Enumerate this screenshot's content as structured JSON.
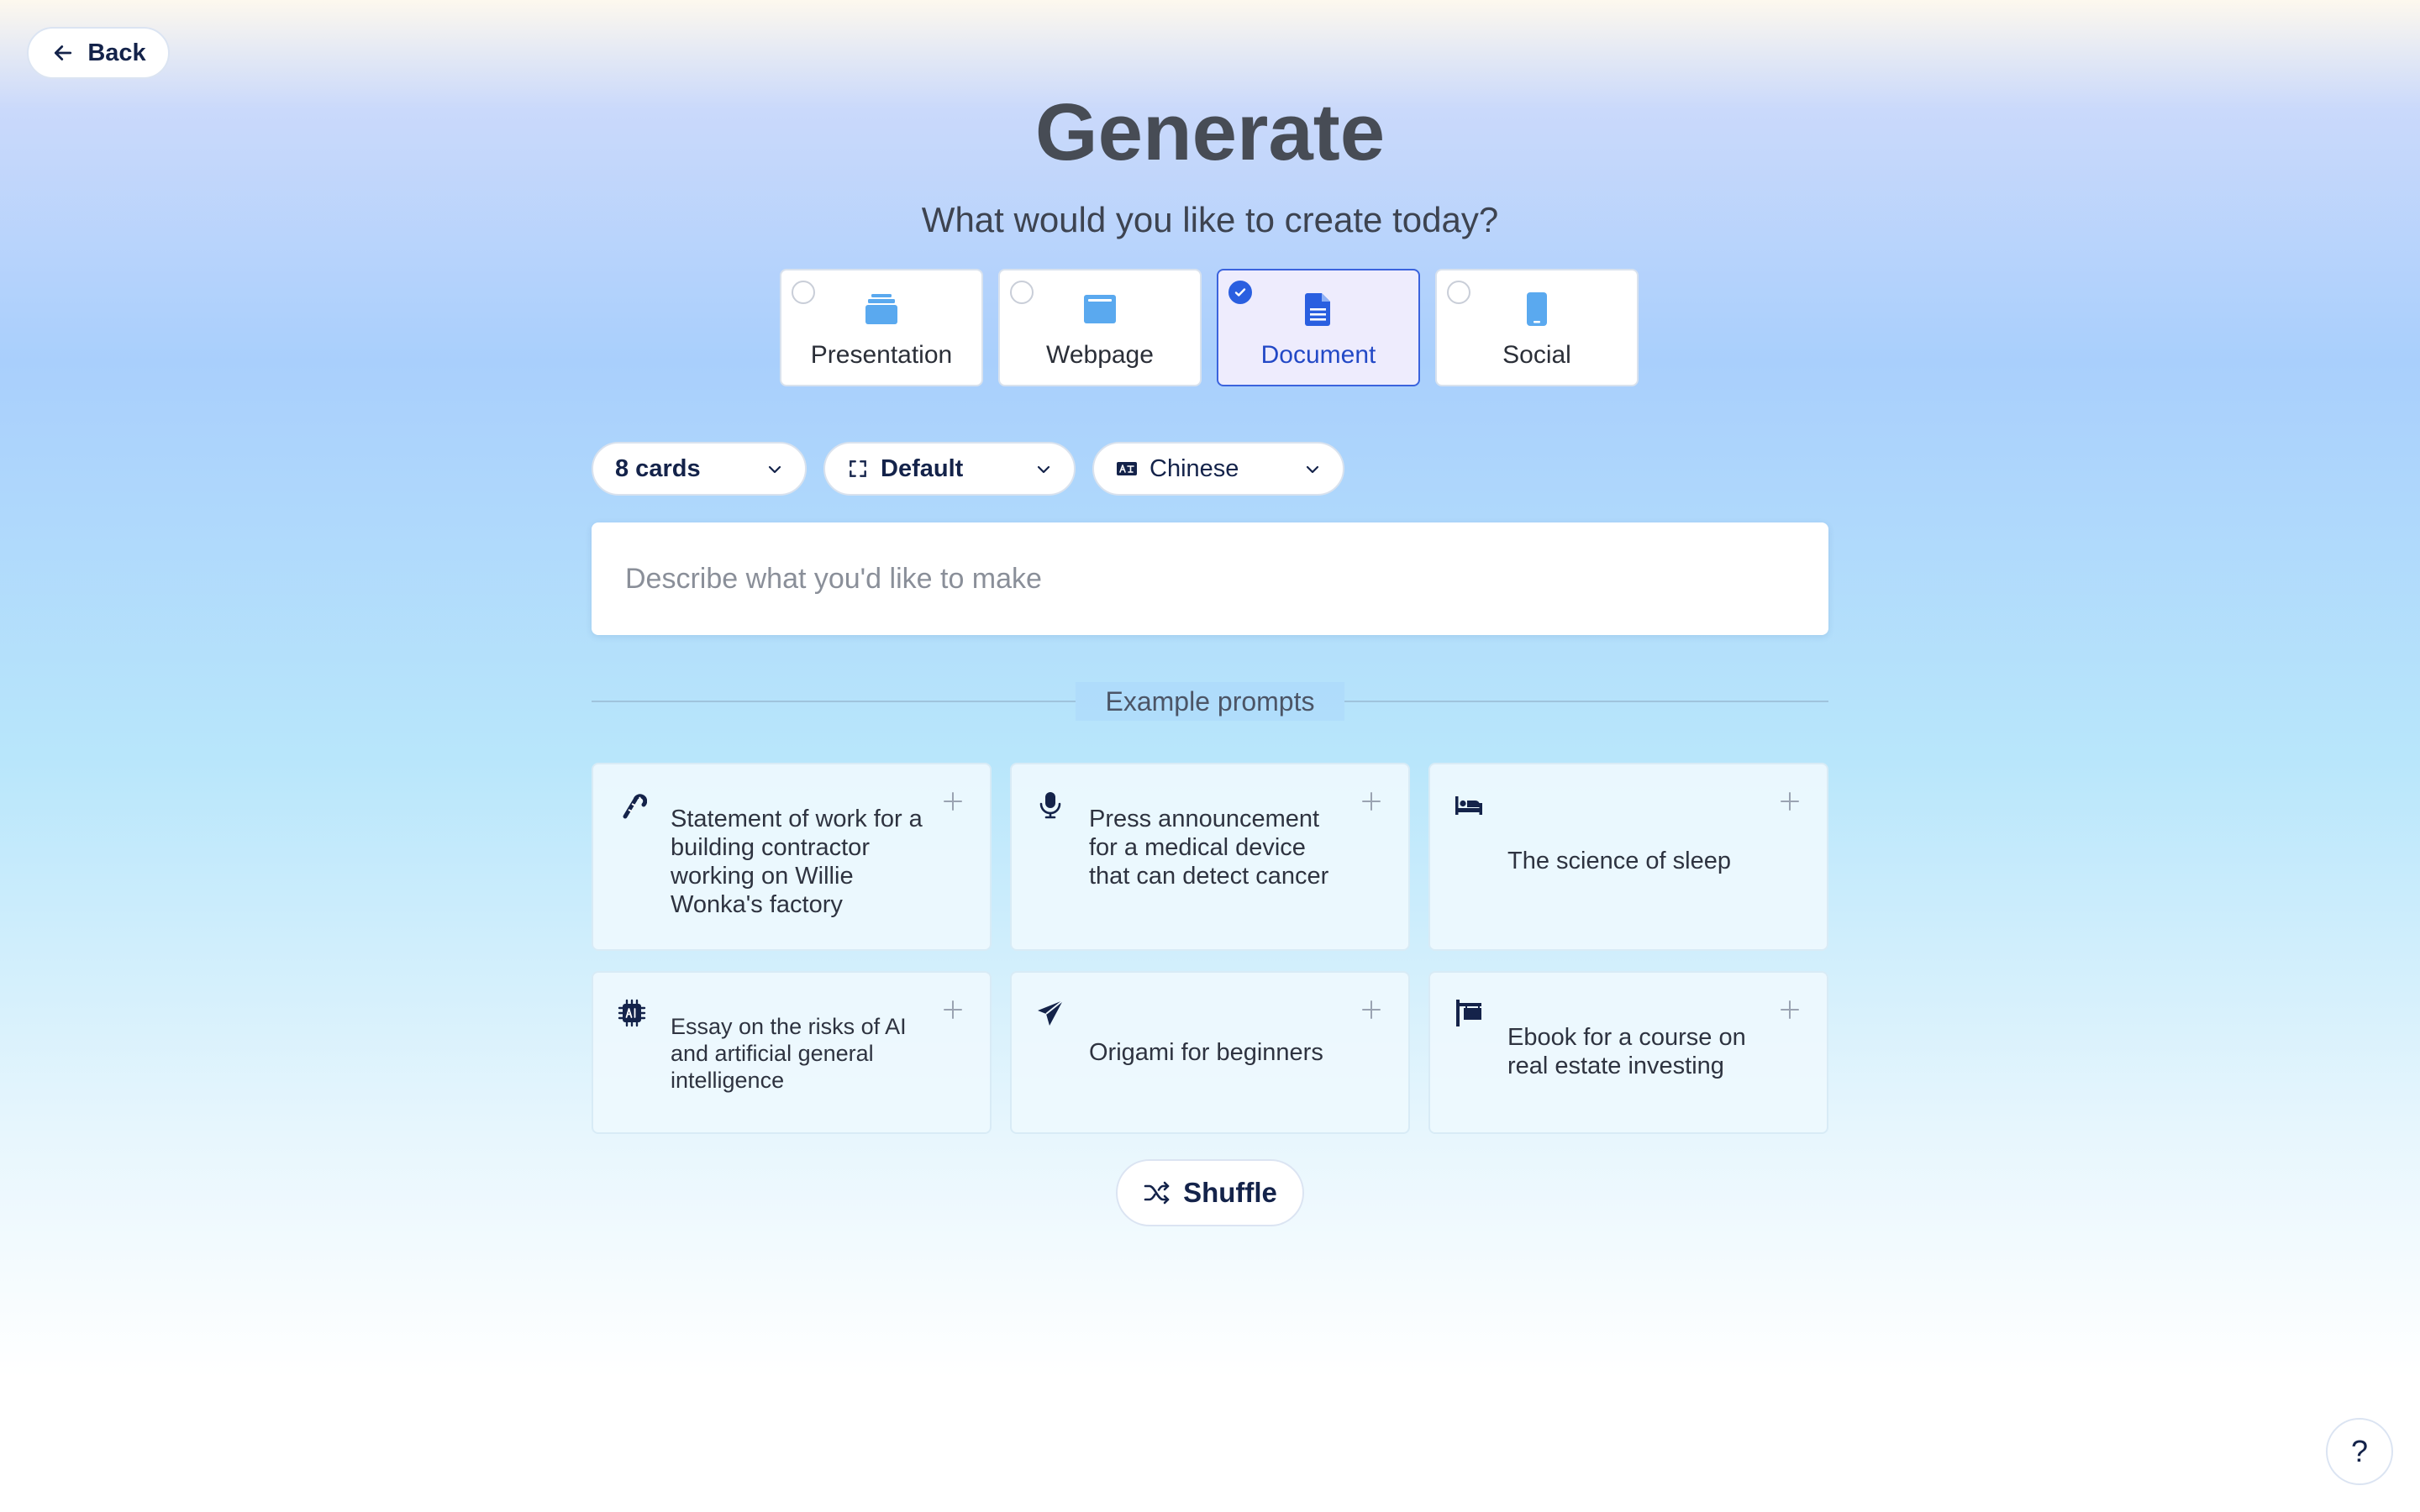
{
  "header": {
    "back_label": "Back",
    "title": "Generate",
    "subtitle": "What would you like to create today?"
  },
  "content_types": [
    {
      "label": "Presentation",
      "icon": "stack-icon",
      "selected": false
    },
    {
      "label": "Webpage",
      "icon": "browser-window-icon",
      "selected": false
    },
    {
      "label": "Document",
      "icon": "document-icon",
      "selected": true
    },
    {
      "label": "Social",
      "icon": "phone-icon",
      "selected": false
    }
  ],
  "controls": {
    "cards": {
      "value": "8 cards"
    },
    "format": {
      "value": "Default",
      "icon": "expand-icon"
    },
    "language": {
      "value": "Chinese",
      "icon": "language-icon"
    }
  },
  "prompt": {
    "placeholder": "Describe what you'd like to make",
    "value": ""
  },
  "examples": {
    "label": "Example prompts",
    "items": [
      {
        "text": "Statement of work for a building contractor working on Willie Wonka's factory",
        "icon": "candy-cane-icon"
      },
      {
        "text": "Press announcement for a medical device that can detect cancer",
        "icon": "microphone-icon"
      },
      {
        "text": "The science of sleep",
        "icon": "bed-icon"
      },
      {
        "text": "Essay on the risks of AI and artificial general intelligence",
        "icon": "ai-chip-icon"
      },
      {
        "text": "Origami for beginners",
        "icon": "paper-plane-icon"
      },
      {
        "text": "Ebook for a course on real estate investing",
        "icon": "signpost-icon"
      }
    ]
  },
  "shuffle_label": "Shuffle",
  "help_label": "?",
  "colors": {
    "accent": "#2a5fe0",
    "icon_blue": "#5aa9ef",
    "navy": "#14234a",
    "selected_bg": "#eeecfd"
  }
}
